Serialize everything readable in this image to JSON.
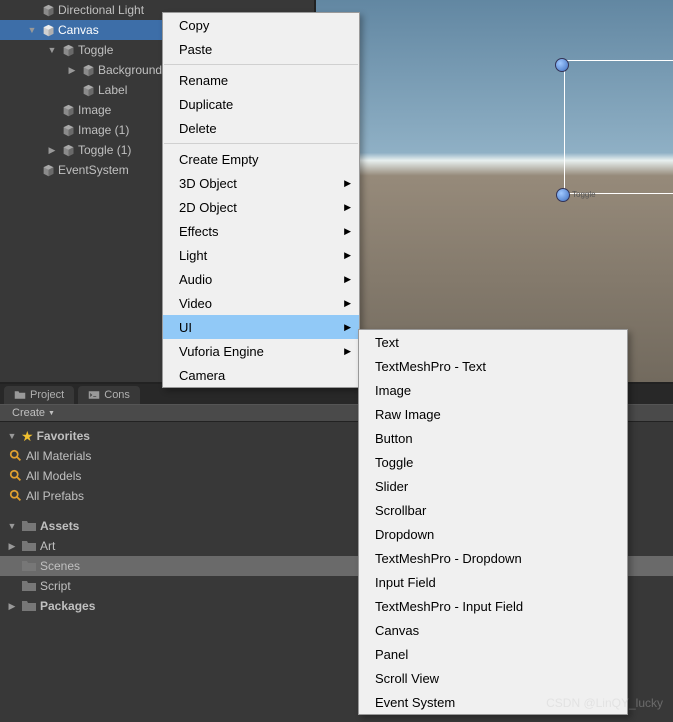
{
  "hierarchy": {
    "items": [
      {
        "label": "Directional Light",
        "indent": 1,
        "foldout": "",
        "selected": false
      },
      {
        "label": "Canvas",
        "indent": 1,
        "foldout": "▼",
        "selected": true
      },
      {
        "label": "Toggle",
        "indent": 2,
        "foldout": "▼",
        "selected": false
      },
      {
        "label": "Background",
        "indent": 3,
        "foldout": "▶",
        "selected": false
      },
      {
        "label": "Label",
        "indent": 3,
        "foldout": "",
        "selected": false
      },
      {
        "label": "Image",
        "indent": 2,
        "foldout": "",
        "selected": false
      },
      {
        "label": "Image (1)",
        "indent": 2,
        "foldout": "",
        "selected": false
      },
      {
        "label": "Toggle (1)",
        "indent": 2,
        "foldout": "▶",
        "selected": false
      },
      {
        "label": "EventSystem",
        "indent": 1,
        "foldout": "",
        "selected": false
      }
    ]
  },
  "contextMenu": {
    "group1": [
      "Copy",
      "Paste"
    ],
    "group2": [
      "Rename",
      "Duplicate",
      "Delete"
    ],
    "group3": [
      {
        "label": "Create Empty",
        "sub": false
      },
      {
        "label": "3D Object",
        "sub": true
      },
      {
        "label": "2D Object",
        "sub": true
      },
      {
        "label": "Effects",
        "sub": true
      },
      {
        "label": "Light",
        "sub": true
      },
      {
        "label": "Audio",
        "sub": true
      },
      {
        "label": "Video",
        "sub": true
      },
      {
        "label": "UI",
        "sub": true,
        "hover": true
      },
      {
        "label": "Vuforia Engine",
        "sub": true
      },
      {
        "label": "Camera",
        "sub": false
      }
    ]
  },
  "uiSubmenu": [
    "Text",
    "TextMeshPro - Text",
    "Image",
    "Raw Image",
    "Button",
    "Toggle",
    "Slider",
    "Scrollbar",
    "Dropdown",
    "TextMeshPro - Dropdown",
    "Input Field",
    "TextMeshPro - Input Field",
    "Canvas",
    "Panel",
    "Scroll View",
    "Event System"
  ],
  "scene": {
    "gizmoLabel": "Toggle"
  },
  "projectPanel": {
    "tabs": {
      "project": "Project",
      "console": "Cons"
    },
    "toolbar": {
      "create": "Create"
    },
    "favorites": {
      "label": "Favorites",
      "items": [
        "All Materials",
        "All Models",
        "All Prefabs"
      ]
    },
    "assets": {
      "label": "Assets",
      "items": [
        "Art",
        "Scenes",
        "Script"
      ],
      "selectedIndex": 1
    },
    "packages": {
      "label": "Packages"
    }
  },
  "watermark": "CSDN @LinQY_lucky"
}
